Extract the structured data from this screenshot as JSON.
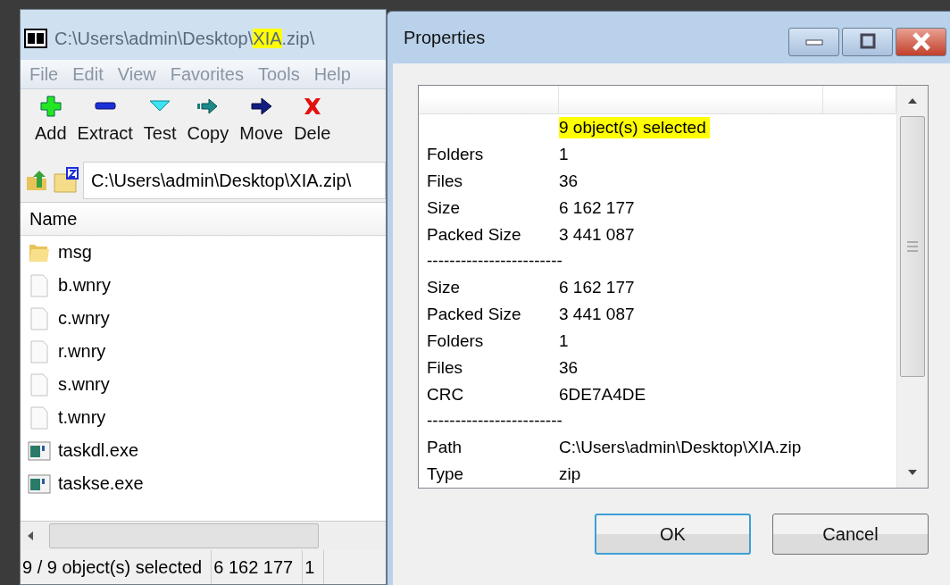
{
  "main_window": {
    "title": [
      {
        "text": "C:\\Users\\admin\\Desktop\\",
        "highlighted": false
      },
      {
        "text": "XIA",
        "highlighted": true
      },
      {
        "text": ".zip\\",
        "highlighted": false
      }
    ],
    "menu": [
      "File",
      "Edit",
      "View",
      "Favorites",
      "Tools",
      "Help"
    ],
    "toolbar": [
      "Add",
      "Extract",
      "Test",
      "Copy",
      "Move",
      "Dele"
    ],
    "address": "C:\\Users\\admin\\Desktop\\XIA.zip\\",
    "columns": [
      "Name"
    ],
    "files": [
      {
        "name": "msg",
        "kind": "folder"
      },
      {
        "name": "b.wnry",
        "kind": "file"
      },
      {
        "name": "c.wnry",
        "kind": "file"
      },
      {
        "name": "r.wnry",
        "kind": "file"
      },
      {
        "name": "s.wnry",
        "kind": "file"
      },
      {
        "name": "t.wnry",
        "kind": "file"
      },
      {
        "name": "taskdl.exe",
        "kind": "exe"
      },
      {
        "name": "taskse.exe",
        "kind": "exe"
      }
    ],
    "status_bar": [
      "9 / 9 object(s) selected",
      "6 162 177",
      "1"
    ]
  },
  "dialog": {
    "title": "Properties",
    "rows": [
      {
        "value": "9 object(s) selected",
        "highlighted": true
      },
      {
        "label": "Folders",
        "value": "1",
        "highlighted": false
      },
      {
        "label": "Files",
        "value": "36",
        "highlighted": false
      },
      {
        "label": "Size",
        "value": "6 162 177",
        "highlighted": false
      },
      {
        "label": "Packed Size",
        "value": "3 441 087",
        "highlighted": false
      },
      {
        "label": "------------------------"
      },
      {
        "label": "Size",
        "value": "6 162 177",
        "highlighted": false
      },
      {
        "label": "Packed Size",
        "value": "3 441 087",
        "highlighted": false
      },
      {
        "label": "Folders",
        "value": "1",
        "highlighted": false
      },
      {
        "label": "Files",
        "value": "36",
        "highlighted": false
      },
      {
        "label": "CRC",
        "value": "6DE7A4DE",
        "highlighted": false
      },
      {
        "label": "------------------------"
      },
      {
        "label": "Path",
        "value": "C:\\Users\\admin\\Desktop\\XIA.zip",
        "highlighted": false
      },
      {
        "label": "Type",
        "value": "zip",
        "highlighted": false
      }
    ],
    "buttons": [
      {
        "label": "OK",
        "selected": true
      },
      {
        "label": "Cancel",
        "selected": false
      }
    ]
  }
}
